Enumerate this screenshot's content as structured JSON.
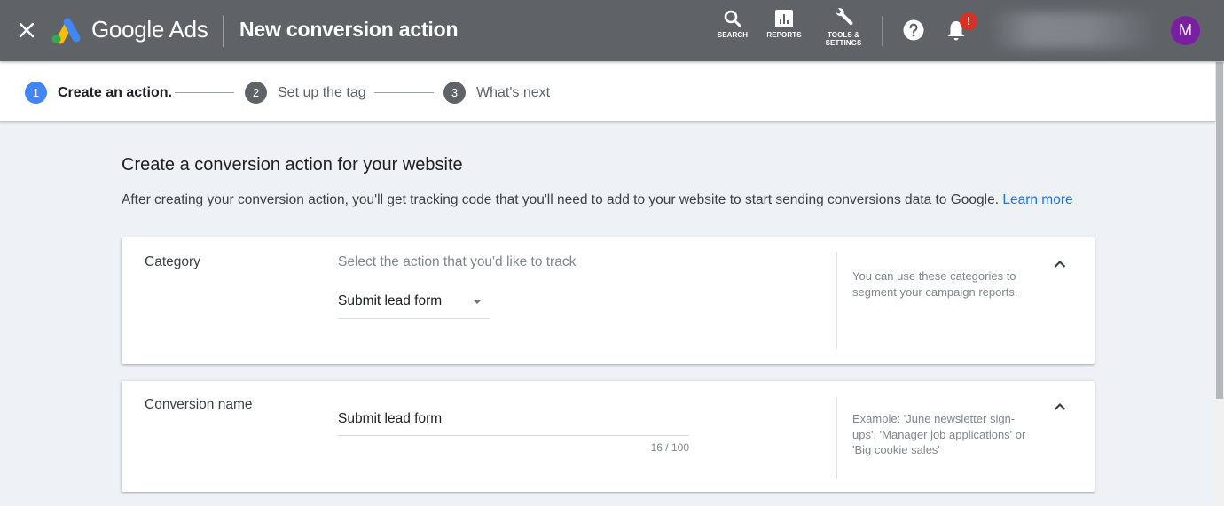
{
  "header": {
    "close_label": "Close",
    "brand": "Google Ads",
    "title": "New conversion action",
    "nav": [
      {
        "id": "search",
        "label": "SEARCH",
        "icon": "search-icon"
      },
      {
        "id": "reports",
        "label": "REPORTS",
        "icon": "reports-icon"
      },
      {
        "id": "tools",
        "label": "TOOLS &",
        "label2": "SETTINGS",
        "icon": "wrench-icon"
      }
    ],
    "help_icon": "help-icon",
    "notifications_icon": "bell-icon",
    "notification_badge": "!",
    "avatar_initial": "M",
    "colors": {
      "bar": "#5f6368",
      "avatar": "#7b1fa2",
      "badge": "#d93025"
    }
  },
  "stepper": {
    "steps": [
      {
        "number": "1",
        "label": "Create an action.",
        "state": "active"
      },
      {
        "number": "2",
        "label": "Set up the tag",
        "state": "inactive"
      },
      {
        "number": "3",
        "label": "What's next",
        "state": "inactive"
      }
    ],
    "active_color": "#4285f4"
  },
  "main": {
    "heading": "Create a conversion action for your website",
    "description": "After creating your conversion action, you'll get tracking code that you'll need to add to your website to start sending conversions data to Google.",
    "learn_more": "Learn more",
    "cards": {
      "category": {
        "label": "Category",
        "prompt": "Select the action that you'd like to track",
        "selected_value": "Submit lead form",
        "help": "You can use these categories to segment your campaign reports."
      },
      "conversion_name": {
        "label": "Conversion name",
        "value": "Submit lead form",
        "char_count": "16 / 100",
        "help": "Example: 'June newsletter sign-ups', 'Manager job applications' or 'Big cookie sales'"
      }
    }
  }
}
